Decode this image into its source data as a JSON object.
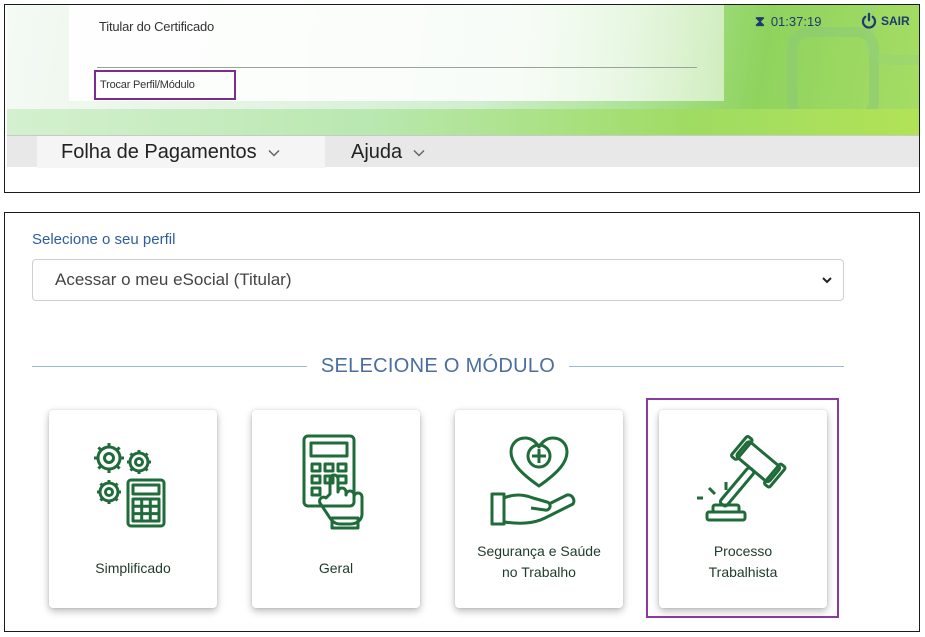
{
  "header": {
    "certificate_title": "Titular do Certificado",
    "switch_profile_link": "Trocar Perfil/Módulo",
    "session_timer": "01:37:19",
    "logout_label": "SAIR"
  },
  "menu": {
    "items": [
      {
        "label": "Folha de Pagamentos"
      },
      {
        "label": "Ajuda"
      }
    ]
  },
  "profile": {
    "label": "Selecione o seu perfil",
    "selected_value": "Acessar o meu eSocial (Titular)"
  },
  "modules": {
    "heading": "SELECIONE O MÓDULO",
    "items": [
      {
        "label": "Simplificado",
        "icon": "gears-calculator-icon"
      },
      {
        "label": "Geral",
        "icon": "calculator-hand-icon"
      },
      {
        "label_line1": "Segurança e Saúde",
        "label_line2": "no Trabalho",
        "icon": "heart-hand-icon"
      },
      {
        "label_line1": "Processo",
        "label_line2": "Trabalhista",
        "icon": "gavel-icon"
      }
    ]
  },
  "colors": {
    "highlight": "#8b3aa0",
    "icon_green": "#1f6b3a",
    "link_blue": "#2c5e9e"
  }
}
